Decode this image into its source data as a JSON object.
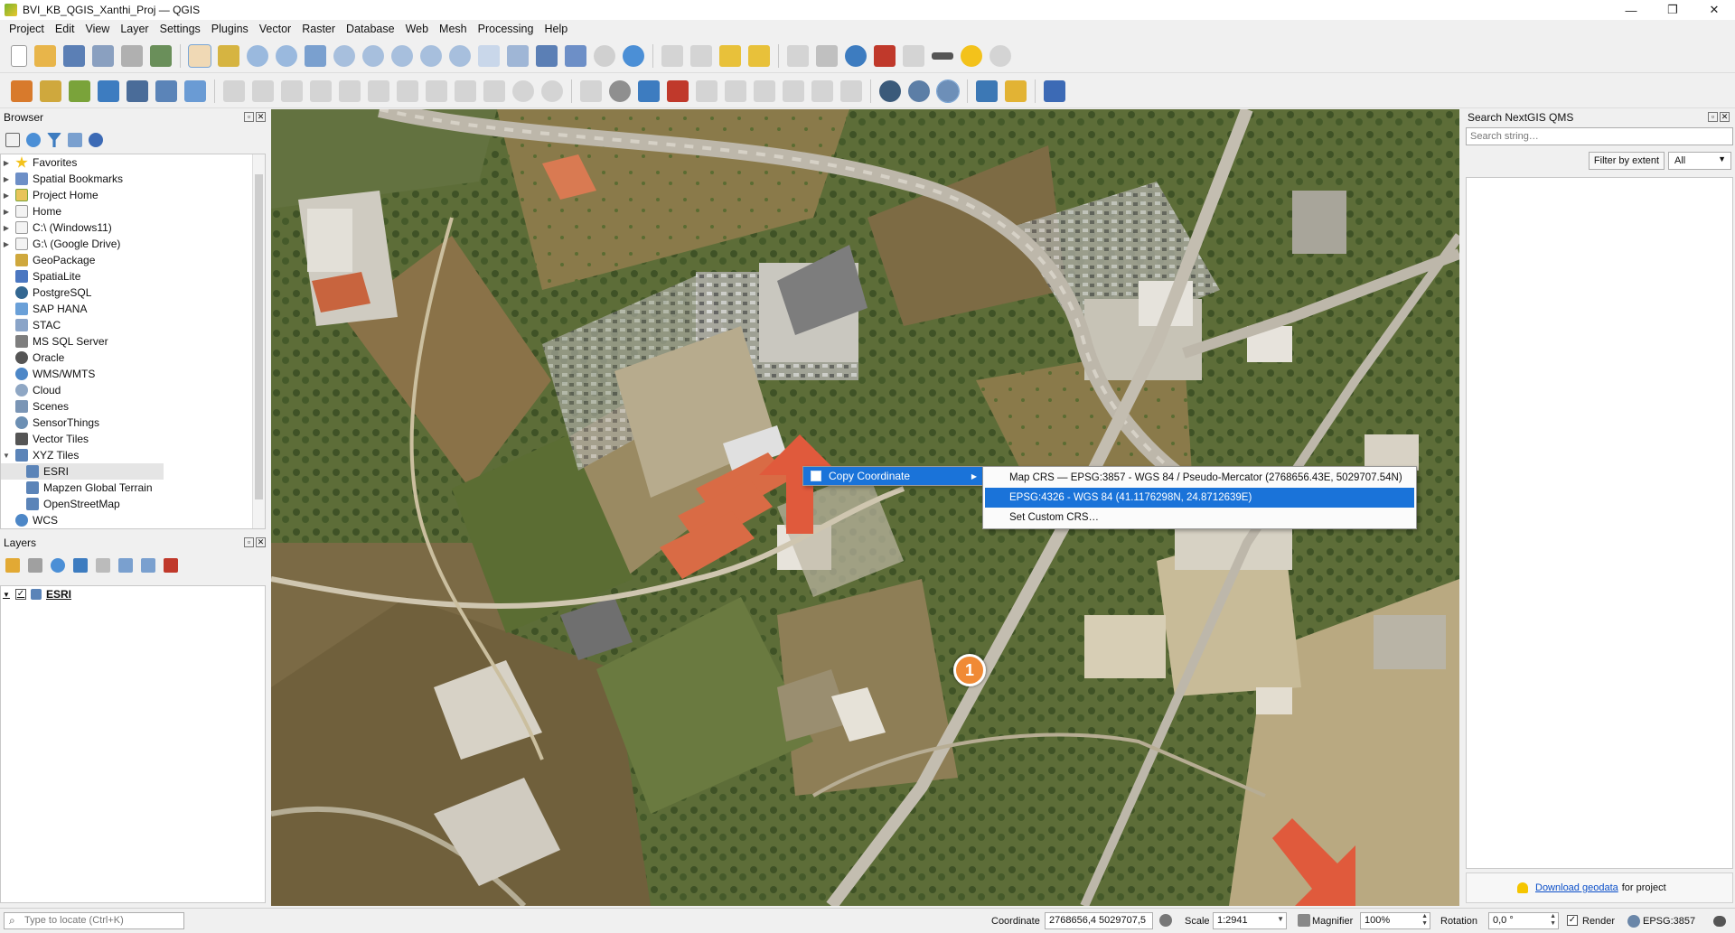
{
  "window": {
    "title": "BVI_KB_QGIS_Xanthi_Proj — QGIS",
    "minimize": "—",
    "maximize": "❐",
    "close": "✕"
  },
  "menubar": [
    "Project",
    "Edit",
    "View",
    "Layer",
    "Settings",
    "Plugins",
    "Vector",
    "Raster",
    "Database",
    "Web",
    "Mesh",
    "Processing",
    "Help"
  ],
  "browser": {
    "title": "Browser",
    "items": [
      {
        "label": "Favorites",
        "icon": "star-icon",
        "color": "#f3c21b"
      },
      {
        "label": "Spatial Bookmarks",
        "icon": "bookmark-icon",
        "color": "#6d8fc7"
      },
      {
        "label": "Project Home",
        "icon": "folder-icon",
        "color": "#7aa33a"
      },
      {
        "label": "Home",
        "icon": "folder-icon",
        "color": "#dcdcdc"
      },
      {
        "label": "C:\\ (Windows11)",
        "icon": "folder-icon",
        "color": "#dcdcdc"
      },
      {
        "label": "G:\\ (Google Drive)",
        "icon": "folder-icon",
        "color": "#dcdcdc"
      },
      {
        "label": "GeoPackage",
        "icon": "geopackage-icon",
        "color": "#cfa83d"
      },
      {
        "label": "SpatiaLite",
        "icon": "spatialite-icon",
        "color": "#4b77c1"
      },
      {
        "label": "PostgreSQL",
        "icon": "postgresql-icon",
        "color": "#336791"
      },
      {
        "label": "SAP HANA",
        "icon": "sap-hana-icon",
        "color": "#6aa0d8"
      },
      {
        "label": "STAC",
        "icon": "stac-icon",
        "color": "#8aa4c8"
      },
      {
        "label": "MS SQL Server",
        "icon": "mssql-icon",
        "color": "#7e7e7e"
      },
      {
        "label": "Oracle",
        "icon": "oracle-icon",
        "color": "#555555"
      },
      {
        "label": "WMS/WMTS",
        "icon": "globe-icon",
        "color": "#4d87c7"
      },
      {
        "label": "Cloud",
        "icon": "cloud-icon",
        "color": "#8fa7c4"
      },
      {
        "label": "Scenes",
        "icon": "scenes-icon",
        "color": "#7a95b5"
      },
      {
        "label": "SensorThings",
        "icon": "sensor-icon",
        "color": "#6c8fb3"
      },
      {
        "label": "Vector Tiles",
        "icon": "grid-icon",
        "color": "#555555"
      },
      {
        "label": "XYZ Tiles",
        "icon": "grid-icon",
        "color": "#5b84b8"
      },
      {
        "label": "ESRI",
        "icon": "grid-icon",
        "color": "#5b84b8"
      },
      {
        "label": "Mapzen Global Terrain",
        "icon": "grid-icon",
        "color": "#5b84b8"
      },
      {
        "label": "OpenStreetMap",
        "icon": "grid-icon",
        "color": "#5b84b8"
      },
      {
        "label": "WCS",
        "icon": "globe-icon",
        "color": "#4d87c7"
      }
    ]
  },
  "layers": {
    "title": "Layers",
    "items": [
      {
        "label": "ESRI",
        "checked": "✓",
        "expander": "▼"
      }
    ]
  },
  "qms": {
    "title": "Search NextGIS QMS",
    "search_placeholder": "Search string…",
    "filter_label": "Filter by extent",
    "select_value": "All",
    "download_link": "Download geodata",
    "download_suffix": "for project"
  },
  "context_menu": {
    "item": "Copy Coordinate",
    "submenu": [
      "Map CRS — EPSG:3857 - WGS 84 / Pseudo-Mercator (2768656.43E, 5029707.54N)",
      "EPSG:4326 - WGS 84 (41.1176298N, 24.8712639E)",
      "Set Custom CRS…"
    ]
  },
  "annotation": {
    "step": "1"
  },
  "statusbar": {
    "locate_placeholder": "Type to locate (Ctrl+K)",
    "coordinate_label": "Coordinate",
    "coordinate_value": "2768656,4  5029707,5",
    "scale_label": "Scale",
    "scale_value": "1:2941",
    "magnifier_label": "Magnifier",
    "magnifier_value": "100%",
    "rotation_label": "Rotation",
    "rotation_value": "0,0 °",
    "render_label": "Render",
    "render_checked": "✓",
    "crs": "EPSG:3857"
  },
  "colors": {
    "selection": "#1a73d9",
    "arrow": "#e05a3c",
    "bullet": "#f08a35"
  }
}
